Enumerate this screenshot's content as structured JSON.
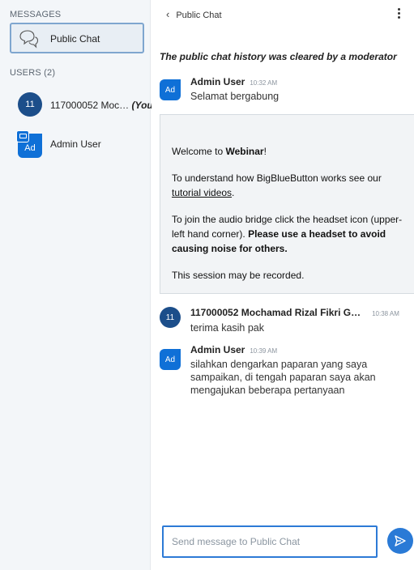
{
  "sidebar": {
    "messages_title": "MESSAGES",
    "public_chat_label": "Public Chat",
    "users_title": "USERS (2)",
    "users": [
      {
        "initials": "11",
        "name": "117000052 Moc…",
        "you_label": "(You)"
      },
      {
        "initials": "Ad",
        "name": "Admin User"
      }
    ]
  },
  "chat": {
    "back_label": "Public Chat",
    "cleared_notice": "The public chat history was cleared by a moderator",
    "messages": [
      {
        "initials": "Ad",
        "sender": "Admin User",
        "time": "10:32 AM",
        "text": "Selamat bergabung"
      },
      {
        "initials": "11",
        "sender": "117000052 Mochamad Rizal Fikri G…",
        "time": "10:38 AM",
        "text": "terima kasih pak"
      },
      {
        "initials": "Ad",
        "sender": "Admin User",
        "time": "10:39 AM",
        "text": "silahkan dengarkan paparan yang saya sampaikan, di tengah paparan saya akan mengajukan beberapa pertanyaan"
      }
    ],
    "welcome": {
      "line1_prefix": "Welcome to ",
      "line1_bold": "Webinar",
      "line1_suffix": "!",
      "line2_prefix": "To understand how BigBlueButton works see our ",
      "line2_link": "tutorial videos",
      "line2_suffix": ".",
      "line3_prefix": "To join the audio bridge click the headset icon (upper-left hand corner). ",
      "line3_bold": "Please use a headset to avoid causing noise for others.",
      "line4": "This session may be recorded."
    },
    "composer_placeholder": "Send message to Public Chat"
  }
}
